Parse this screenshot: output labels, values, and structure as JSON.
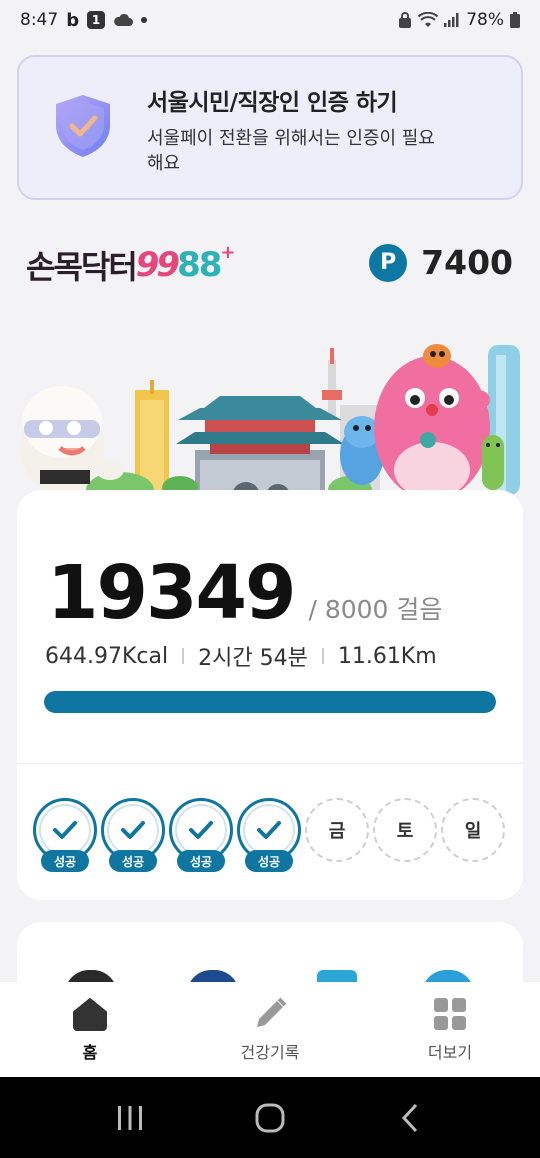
{
  "status_bar": {
    "time": "8:47",
    "notification_badge": "1",
    "battery": "78%"
  },
  "cert_banner": {
    "title": "서울시민/직장인 인증 하기",
    "description": "서울페이 전환을 위해서는 인증이 필요해요"
  },
  "brand": {
    "name_part1": "손목닥터",
    "name_part2": "99",
    "name_part3": "88",
    "name_plus": "+"
  },
  "points": {
    "icon_label": "P",
    "value": "7400"
  },
  "steps": {
    "count": "19349",
    "goal": "/ 8000 걸음",
    "progress_fraction": 1.0,
    "kcal": "644.97Kcal",
    "duration": "2시간 54분",
    "distance": "11.61Km"
  },
  "week": {
    "days": [
      {
        "label": "",
        "success": true,
        "badge": "성공"
      },
      {
        "label": "",
        "success": true,
        "badge": "성공"
      },
      {
        "label": "",
        "success": true,
        "badge": "성공"
      },
      {
        "label": "",
        "success": true,
        "badge": "성공"
      },
      {
        "label": "금",
        "success": false,
        "badge": ""
      },
      {
        "label": "토",
        "success": false,
        "badge": ""
      },
      {
        "label": "일",
        "success": false,
        "badge": ""
      }
    ]
  },
  "bottom_nav": {
    "items": [
      {
        "label": "홈",
        "icon": "home-icon",
        "active": true
      },
      {
        "label": "건강기록",
        "icon": "pencil-icon",
        "active": false
      },
      {
        "label": "더보기",
        "icon": "grid-icon",
        "active": false
      }
    ]
  },
  "colors": {
    "accent": "#0f76a1",
    "brand_pink": "#e6477a",
    "brand_teal": "#2cb2b7"
  }
}
